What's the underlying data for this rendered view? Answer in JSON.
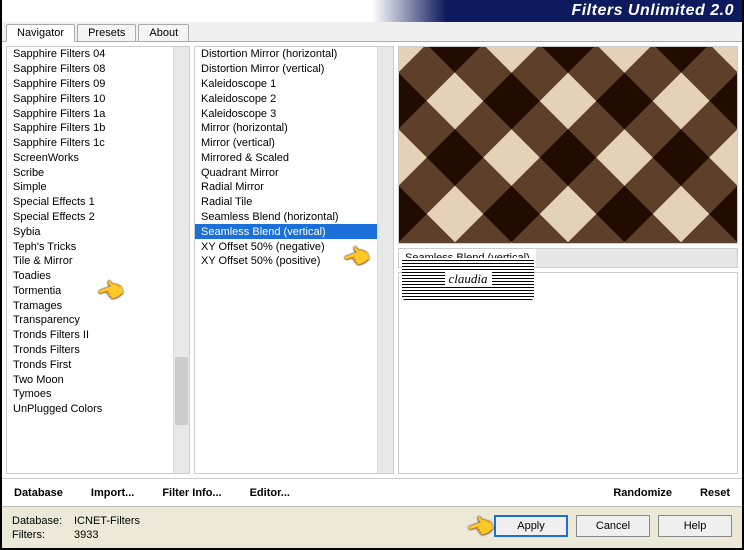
{
  "title": "Filters Unlimited 2.0",
  "tabs": [
    "Navigator",
    "Presets",
    "About"
  ],
  "activeTab": 0,
  "leftList": [
    "Sapphire Filters 04",
    "Sapphire Filters 08",
    "Sapphire Filters 09",
    "Sapphire Filters 10",
    "Sapphire Filters 1a",
    "Sapphire Filters 1b",
    "Sapphire Filters 1c",
    "ScreenWorks",
    "Scribe",
    "Simple",
    "Special Effects 1",
    "Special Effects 2",
    "Sybia",
    "Teph's Tricks",
    "Tile & Mirror",
    "Toadies",
    "Tormentia",
    "Tramages",
    "Transparency",
    "Tronds Filters II",
    "Tronds Filters",
    "Tronds First",
    "Two Moon",
    "Tymoes",
    "UnPlugged Colors"
  ],
  "leftSelected": 14,
  "midList": [
    "Distortion Mirror (horizontal)",
    "Distortion Mirror (vertical)",
    "Kaleidoscope 1",
    "Kaleidoscope 2",
    "Kaleidoscope 3",
    "Mirror (horizontal)",
    "Mirror (vertical)",
    "Mirrored & Scaled",
    "Quadrant Mirror",
    "Radial Mirror",
    "Radial Tile",
    "Seamless Blend (horizontal)",
    "Seamless Blend (vertical)",
    "XY Offset 50% (negative)",
    "XY Offset 50% (positive)"
  ],
  "midSelected": 12,
  "currentFilter": "Seamless Blend (vertical)",
  "toolbar": {
    "database": "Database",
    "import": "Import...",
    "filterInfo": "Filter Info...",
    "editor": "Editor...",
    "randomize": "Randomize",
    "reset": "Reset"
  },
  "status": {
    "dbLabel": "Database:",
    "dbValue": "ICNET-Filters",
    "filtersLabel": "Filters:",
    "filtersValue": "3933"
  },
  "buttons": {
    "apply": "Apply",
    "cancel": "Cancel",
    "help": "Help"
  },
  "watermark": "claudia"
}
